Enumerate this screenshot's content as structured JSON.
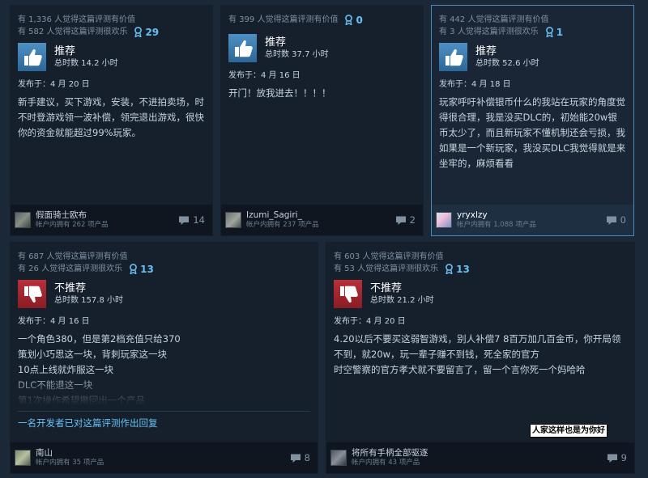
{
  "reviews": [
    {
      "helpful": "有 1,336 人觉得这篇评测有价值",
      "funny": "有 582 人觉得这篇评测很欢乐",
      "awards": "29",
      "verdict": "推荐",
      "hours": "总时数 14.2 小时",
      "posted": "发布于：4 月 20 日",
      "content": "新手建议，买下游戏，安装，不进拍卖场，时不时登游戏领一波补偿，领完退出游戏，很快你的资金就能超过99%玩家。",
      "author": "假面骑士欧布",
      "owned": "帐户内拥有 262 项产品",
      "comments": "14"
    },
    {
      "helpful": "有 399 人觉得这篇评测有价值",
      "funny": "",
      "awards": "0",
      "verdict": "推荐",
      "hours": "总时数 37.7 小时",
      "posted": "发布于：4 月 16 日",
      "content": "开门！放我进去！！！！",
      "author": "Izumi_Sagiri_",
      "owned": "帐户内拥有 237 项产品",
      "comments": "2"
    },
    {
      "helpful": "有 442 人觉得这篇评测有价值",
      "funny": "有 3 人觉得这篇评测很欢乐",
      "awards": "1",
      "verdict": "推荐",
      "hours": "总时数 52.6 小时",
      "posted": "发布于：4 月 18 日",
      "content": "玩家呼吁补偿银币什么的我站在玩家的角度觉得很合理，我是没买DLC的，初始能20w银币太少了，而且新玩家不懂机制还会亏损，我如果是一个新玩家，我没买DLC我觉得就是来坐牢的，麻烦看看",
      "author": "yryxlzy",
      "owned": "帐户内拥有 1,088 项产品",
      "comments": "0"
    },
    {
      "helpful": "有 687 人觉得这篇评测有价值",
      "funny": "有 26 人觉得这篇评测很欢乐",
      "awards": "13",
      "verdict": "不推荐",
      "hours": "总时数 157.8 小时",
      "posted": "发布于：4 月 16 日",
      "content": "一个角色380，但是第2档充值只给370\n策划小巧思这一块，背刺玩家这一块\n10点上线就炸服这一块\nDLC不能退这一块\n第1次操作希望撤回出一个产品",
      "dev_reply": "一名开发者已对这篇评测作出回复",
      "author": "南山",
      "owned": "帐户内拥有 35 项产品",
      "comments": "8"
    },
    {
      "helpful": "有 603 人觉得这篇评测有价值",
      "funny": "有 53 人觉得这篇评测很欢乐",
      "awards": "13",
      "verdict": "不推荐",
      "hours": "总时数 21.2 小时",
      "posted": "发布于：4 月 20 日",
      "content": "4.20以后不要买这弱智游戏，别人补偿7 8百万加几百金币，你开局领不到，就20w，玩一辈子赚不到钱，死全家的官方\n时空警察的官方孝犬就不要留言了，留一个言你死一个妈哈哈",
      "author": "将所有手柄全部驱逐",
      "owned": "帐户内拥有 43 项产品",
      "comments": "9"
    }
  ],
  "caption": "人家这样也是为你好",
  "colors": {
    "recommended": "#4e90c4",
    "not_recommended": "#b8303a",
    "award": "#66c0f4"
  },
  "icons": {
    "award": "award-ribbon-icon",
    "up": "thumbs-up-icon",
    "down": "thumbs-down-icon",
    "comment": "comment-bubble-icon"
  }
}
